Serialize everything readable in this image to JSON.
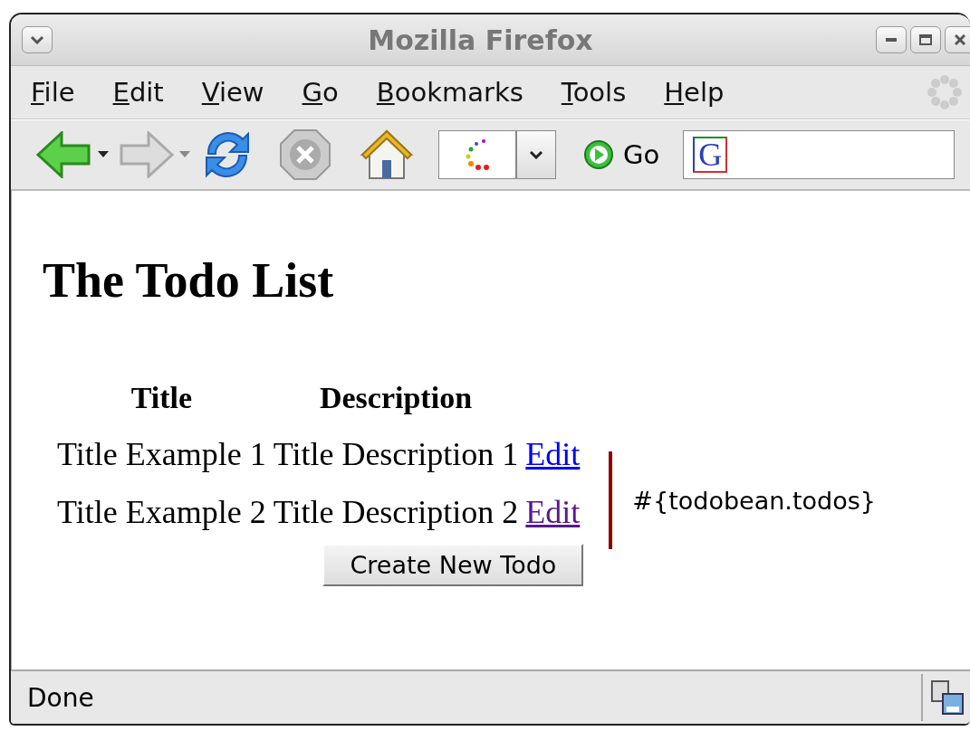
{
  "window": {
    "title": "Mozilla Firefox"
  },
  "menu": [
    {
      "label": "File"
    },
    {
      "label": "Edit"
    },
    {
      "label": "View"
    },
    {
      "label": "Go"
    },
    {
      "label": "Bookmarks"
    },
    {
      "label": "Tools"
    },
    {
      "label": "Help"
    }
  ],
  "toolbar": {
    "go_label": "Go",
    "search_engine": "G"
  },
  "page": {
    "heading": "The Todo List",
    "table": {
      "columns": [
        "Title",
        "Description"
      ],
      "rows": [
        {
          "title": "Title Example 1",
          "description": "Title Description 1",
          "link": "Edit",
          "visited": false
        },
        {
          "title": "Title Example 2",
          "description": "Title Description 2",
          "link": "Edit",
          "visited": true
        }
      ]
    },
    "expression": "#{todobean.todos}",
    "button": "Create New Todo"
  },
  "status_bar": {
    "text": "Done"
  }
}
